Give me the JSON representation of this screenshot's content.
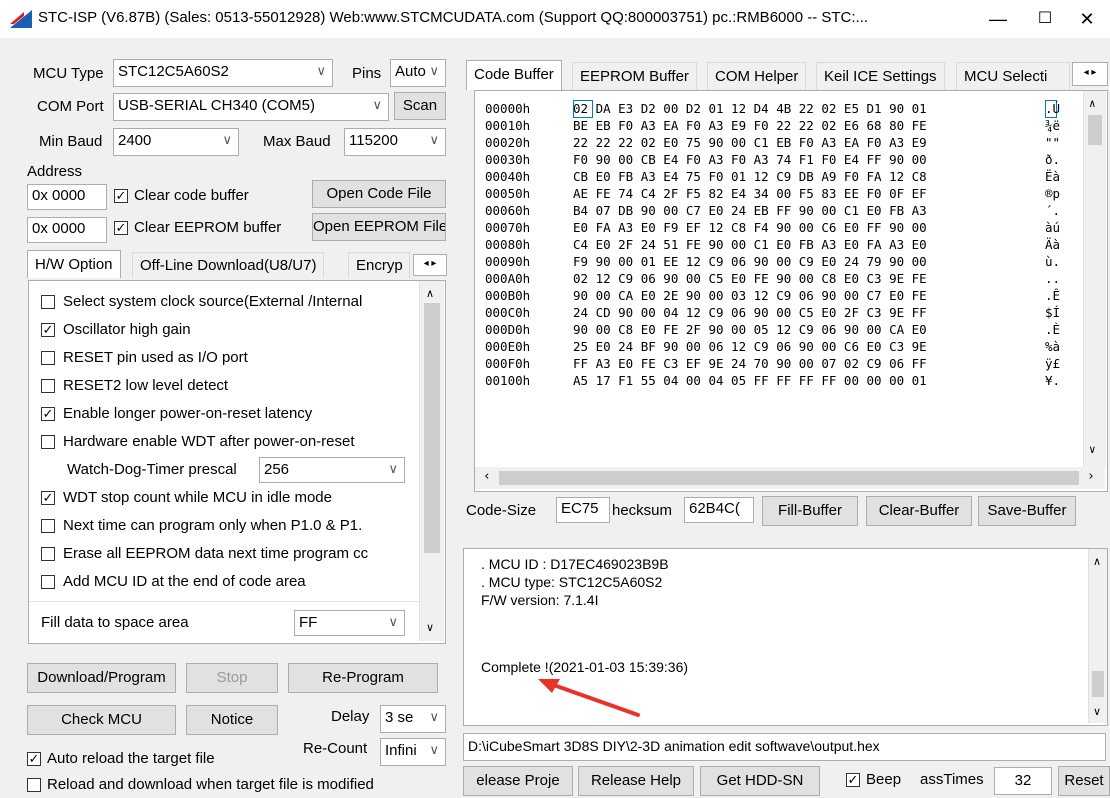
{
  "window": {
    "title": "STC-ISP (V6.87B) (Sales: 0513-55012928) Web:www.STCMCUDATA.com  (Support QQ:800003751)  pc.:RMB6000 -- STC:...",
    "minimize": "—",
    "maximize": "☐",
    "close": "✕"
  },
  "left": {
    "mcu_type_label": "MCU Type",
    "mcu_type_value": "STC12C5A60S2",
    "pins_label": "Pins",
    "pins_value": "Auto",
    "com_port_label": "COM Port",
    "com_port_value": "USB-SERIAL CH340 (COM5)",
    "scan_label": "Scan",
    "min_baud_label": "Min Baud",
    "min_baud_value": "2400",
    "max_baud_label": "Max Baud",
    "max_baud_value": "115200",
    "address_label": "Address",
    "addr1": "0x 0000",
    "clear_code_label": "Clear code buffer",
    "open_code_label": "Open Code File",
    "addr2": "0x 0000",
    "clear_eeprom_label": "Clear EEPROM buffer",
    "open_eeprom_label": "Open EEPROM File",
    "tabs": [
      "H/W Option",
      "Off-Line Download(U8/U7)",
      "Encryp"
    ],
    "hw_options": [
      {
        "label": "Select system clock source(External /Internal",
        "checked": false
      },
      {
        "label": "Oscillator high gain",
        "checked": true
      },
      {
        "label": "RESET pin used as I/O port",
        "checked": false
      },
      {
        "label": "RESET2 low level detect",
        "checked": false
      },
      {
        "label": "Enable longer power-on-reset latency",
        "checked": true
      },
      {
        "label": "Hardware enable WDT after power-on-reset",
        "checked": false
      }
    ],
    "wdt_prescal_label": "Watch-Dog-Timer prescal",
    "wdt_prescal_value": "256",
    "hw_options2": [
      {
        "label": "WDT stop count while MCU in idle mode",
        "checked": true
      },
      {
        "label": "Next time can program only when P1.0 & P1.",
        "checked": false
      },
      {
        "label": "Erase all EEPROM data next time program cc",
        "checked": false
      },
      {
        "label": "Add MCU ID at the end of code area",
        "checked": false
      }
    ],
    "fill_label": "Fill data to space area",
    "fill_value": "FF",
    "download_label": "Download/Program",
    "stop_label": "Stop",
    "reprogram_label": "Re-Program",
    "check_mcu_label": "Check MCU",
    "notice_label": "Notice",
    "delay_label": "Delay",
    "delay_value": "3 se",
    "auto_reload_label": "Auto reload the target file",
    "recount_label": "Re-Count",
    "recount_value": "Infini",
    "reload_modified_label": "Reload and download when target file is modified"
  },
  "right": {
    "tabs": [
      "Code Buffer",
      "EEPROM Buffer",
      "COM Helper",
      "Keil ICE Settings",
      "MCU Selecti"
    ],
    "hex_rows": [
      {
        "addr": "00000h",
        "bytes": "02 DA E3 D2 00 D2 01 12 D4 4B 22 02 E5 D1 90 01",
        "ascii": ".Ú"
      },
      {
        "addr": "00010h",
        "bytes": "BE EB F0 A3 EA F0 A3 E9 F0 22 22 02 E6 68 80 FE",
        "ascii": "¾ë"
      },
      {
        "addr": "00020h",
        "bytes": "22 22 22 02 E0 75 90 00 C1 EB F0 A3 EA F0 A3 E9",
        "ascii": "\"\""
      },
      {
        "addr": "00030h",
        "bytes": "F0 90 00 CB E4 F0 A3 F0 A3 74 F1 F0 E4 FF 90 00",
        "ascii": "ð."
      },
      {
        "addr": "00040h",
        "bytes": "CB E0 FB A3 E4 75 F0 01 12 C9 DB A9 F0 FA 12 C8",
        "ascii": "Ëà"
      },
      {
        "addr": "00050h",
        "bytes": "AE FE 74 C4 2F F5 82 E4 34 00 F5 83 EE F0 0F EF",
        "ascii": "®p"
      },
      {
        "addr": "00060h",
        "bytes": "B4 07 DB 90 00 C7 E0 24 EB FF 90 00 C1 E0 FB A3",
        "ascii": "´."
      },
      {
        "addr": "00070h",
        "bytes": "E0 FA A3 E0 F9 EF 12 C8 F4 90 00 C6 E0 FF 90 00",
        "ascii": "àú"
      },
      {
        "addr": "00080h",
        "bytes": "C4 E0 2F 24 51 FE 90 00 C1 E0 FB A3 E0 FA A3 E0",
        "ascii": "Äà"
      },
      {
        "addr": "00090h",
        "bytes": "F9 90 00 01 EE 12 C9 06 90 00 C9 E0 24 79 90 00",
        "ascii": "ù."
      },
      {
        "addr": "000A0h",
        "bytes": "02 12 C9 06 90 00 C5 E0 FE 90 00 C8 E0 C3 9E FE",
        "ascii": ".."
      },
      {
        "addr": "000B0h",
        "bytes": "90 00 CA E0 2E 90 00 03 12 C9 06 90 00 C7 E0 FE",
        "ascii": ".Ê"
      },
      {
        "addr": "000C0h",
        "bytes": "24 CD 90 00 04 12 C9 06 90 00 C5 E0 2F C3 9E FF",
        "ascii": "$Í"
      },
      {
        "addr": "000D0h",
        "bytes": "90 00 C8 E0 FE 2F 90 00 05 12 C9 06 90 00 CA E0",
        "ascii": ".È"
      },
      {
        "addr": "000E0h",
        "bytes": "25 E0 24 BF 90 00 06 12 C9 06 90 00 C6 E0 C3 9E",
        "ascii": "%à"
      },
      {
        "addr": "000F0h",
        "bytes": "FF A3 E0 FE C3 EF 9E 24 70 90 00 07 02 C9 06 FF",
        "ascii": "ÿ£"
      },
      {
        "addr": "00100h",
        "bytes": "A5 17 F1 55 04 00 04 05 FF FF FF FF 00 00 00 01",
        "ascii": "¥."
      }
    ],
    "code_size_label": "Code-Size",
    "code_size_value": "EC75",
    "checksum_label": "hecksum",
    "checksum_value": "62B4C(",
    "fill_buffer_label": "Fill-Buffer",
    "clear_buffer_label": "Clear-Buffer",
    "save_buffer_label": "Save-Buffer",
    "log_lines": [
      ". MCU ID : D17EC469023B9B",
      ". MCU type: STC12C5A60S2",
      "F/W version: 7.1.4I"
    ],
    "log_complete": "Complete !(2021-01-03 15:39:36)",
    "file_path": "D:\\iCubeSmart 3D8S DIY\\2-3D animation edit softwave\\output.hex",
    "release_project_label": "elease Proje",
    "release_help_label": "Release Help",
    "get_hdd_label": "Get HDD-SN",
    "beep_label": "Beep",
    "passtimes_label": "assTimes",
    "passtimes_value": "32",
    "reset_label": "Reset"
  },
  "colors": {
    "accent": "#0078d7",
    "arrow": "#e8322b"
  }
}
